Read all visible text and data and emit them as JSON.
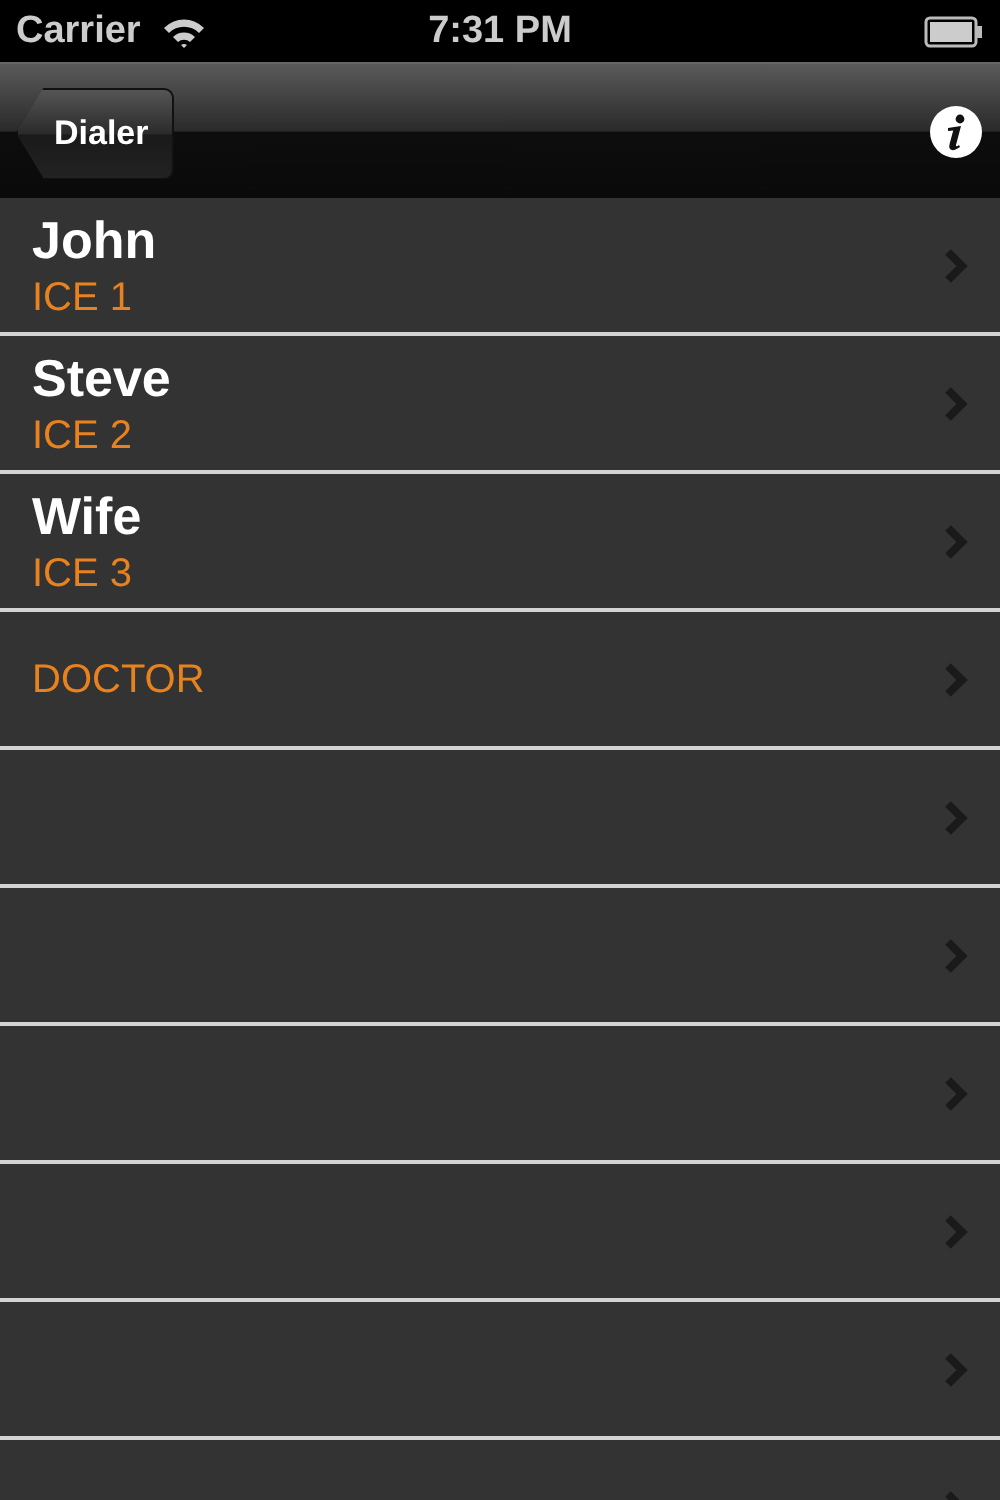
{
  "status_bar": {
    "carrier": "Carrier",
    "time": "7:31 PM"
  },
  "nav_bar": {
    "back_button": "Dialer"
  },
  "rows": [
    {
      "kind": "contact",
      "name": "John",
      "label": "ICE 1"
    },
    {
      "kind": "contact",
      "name": "Steve",
      "label": "ICE 2"
    },
    {
      "kind": "contact",
      "name": "Wife",
      "label": "ICE 3"
    },
    {
      "kind": "label",
      "label": "DOCTOR"
    },
    {
      "kind": "empty"
    },
    {
      "kind": "empty"
    },
    {
      "kind": "empty"
    },
    {
      "kind": "empty"
    },
    {
      "kind": "empty"
    },
    {
      "kind": "empty"
    }
  ]
}
